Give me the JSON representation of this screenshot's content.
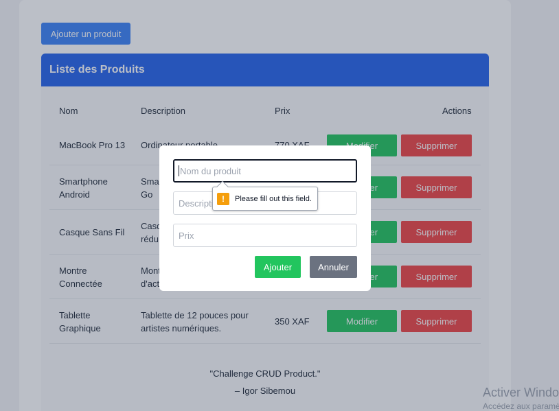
{
  "toolbar": {
    "add_label": "Ajouter un produit"
  },
  "list": {
    "title": "Liste des Produits",
    "columns": {
      "name": "Nom",
      "description": "Description",
      "price": "Prix",
      "actions": "Actions"
    },
    "rows": [
      {
        "name": "MacBook Pro 13",
        "description": "Ordinateur portable",
        "price": "770 XAF",
        "edit": "Modifier",
        "delete": "Supprimer"
      },
      {
        "name": "Smartphone Android",
        "description": "Smar Go",
        "price": "",
        "edit": "Modifier",
        "delete": "Supprimer"
      },
      {
        "name": "Casque Sans Fil",
        "description": "Casq rédu",
        "price": "",
        "edit": "Modifier",
        "delete": "Supprimer"
      },
      {
        "name": "Montre Connectée",
        "description": "Mont d'act",
        "price": "",
        "edit": "Modifier",
        "delete": "Supprimer"
      },
      {
        "name": "Tablette Graphique",
        "description": "Tablette de 12 pouces pour artistes numériques.",
        "price": "350 XAF",
        "edit": "Modifier",
        "delete": "Supprimer"
      }
    ]
  },
  "footer": {
    "quote": "\"Challenge CRUD Product.\"",
    "author": "– Igor Sibemou"
  },
  "modal": {
    "name_placeholder": "Nom du produit",
    "description_placeholder": "Description",
    "price_placeholder": "Prix",
    "submit_label": "Ajouter",
    "cancel_label": "Annuler"
  },
  "validation": {
    "message": "Please fill out this field.",
    "icon": "warning-icon"
  },
  "watermark": {
    "line1": "Activer Windows",
    "line2": "Accédez aux paramètres"
  },
  "colors": {
    "primary": "#3b82f6",
    "header": "#2563eb",
    "success": "#22c55e",
    "danger": "#ef4444",
    "secondary": "#6b7280"
  }
}
